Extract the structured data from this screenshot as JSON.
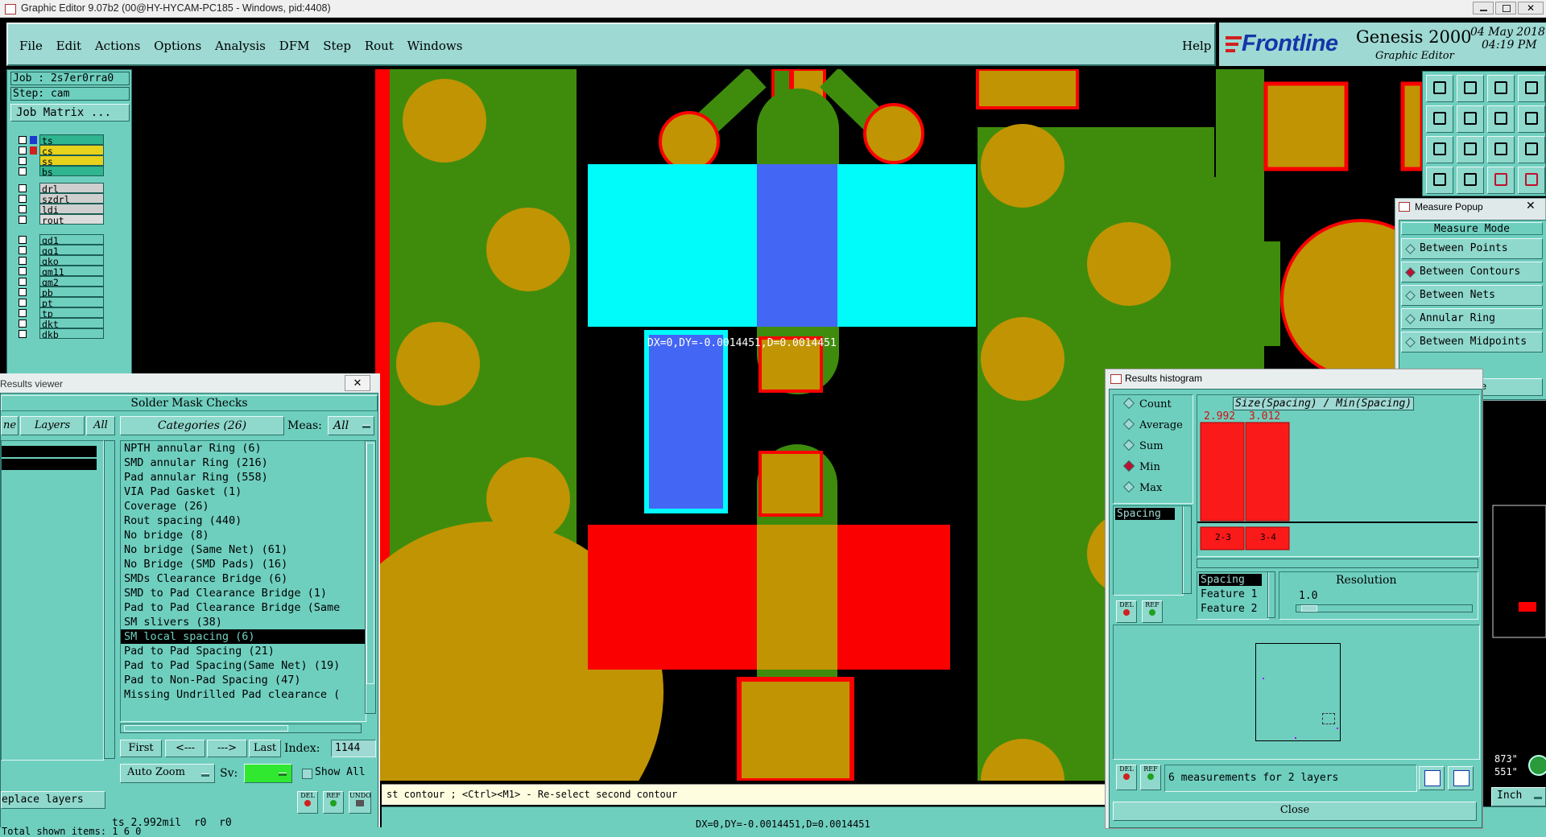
{
  "window": {
    "title": "Graphic Editor 9.07b2 (00@HY-HYCAM-PC185 - Windows, pid:4408)"
  },
  "menu": {
    "items": [
      "File",
      "Edit",
      "Actions",
      "Options",
      "Analysis",
      "DFM",
      "Step",
      "Rout",
      "Windows"
    ],
    "help": "Help"
  },
  "brand": {
    "logo": "Frontline",
    "product": "Genesis 2000",
    "subtitle": "Graphic Editor",
    "date": "04 May 2018",
    "time": "04:19 PM"
  },
  "job": {
    "job": "Job : 2s7er0rra0",
    "step": "Step: cam",
    "matrix_button": "Job Matrix ..."
  },
  "layers": {
    "group1": [
      "ts",
      "cs",
      "ss",
      "bs"
    ],
    "group2": [
      "drl",
      "szdrl",
      "ldi",
      "rout"
    ],
    "group3": [
      "gd1",
      "gg1",
      "gko",
      "gm11",
      "gm2",
      "pb",
      "pt",
      "tp",
      "dkt",
      "dkb"
    ]
  },
  "results_viewer": {
    "title": "Results viewer",
    "header": "Solder Mask Checks",
    "layers_tab": "Layers",
    "all_tab": "All",
    "ne_tab": "ne",
    "categories_label": "Categories (26)",
    "meas_label": "Meas:",
    "meas_value": "All",
    "categories": [
      "NPTH annular Ring (6)",
      "SMD annular Ring (216)",
      "Pad annular Ring (558)",
      "VIA Pad Gasket (1)",
      "Coverage (26)",
      "Rout spacing (440)",
      "No bridge (8)",
      "No bridge (Same Net) (61)",
      "No Bridge (SMD Pads) (16)",
      "SMDs Clearance Bridge (6)",
      "SMD to Pad Clearance Bridge (1)",
      "Pad to Pad Clearance Bridge (Same",
      "SM slivers (38)",
      "SM local spacing (6)",
      "Pad to Pad Spacing (21)",
      "Pad to Pad Spacing(Same Net) (19)",
      "Pad to Non-Pad Spacing (47)",
      "Missing Undrilled Pad clearance ("
    ],
    "selected_category_index": 13,
    "nav": {
      "first": "First",
      "prev": "<---",
      "next": "--->",
      "last": "Last",
      "index_label": "Index:",
      "index_value": "1144"
    },
    "auto_zoom": "Auto Zoom",
    "sv_label": "Sv:",
    "show_all": "Show All",
    "replace_layers": "eplace layers",
    "del": "DEL",
    "ref": "REF",
    "undo": "UNDO"
  },
  "measure_readout": {
    "overlay": "DX=0,DY=-0.0014451,D=0.0014451",
    "bottom": "DX=0,DY=-0.0014451,D=0.0014451"
  },
  "status": {
    "left": "ts 2.992mil  r0  r0",
    "bottom_left": "Total shown items: 1 6 0",
    "hint": "st contour ; <Ctrl><M1> - Re-select second contour",
    "units": "Inch",
    "coords_1": "873\"",
    "coords_2": "551\""
  },
  "measure_popup": {
    "title": "Measure Popup",
    "header": "Measure Mode",
    "modes": [
      "Between Points",
      "Between Contours",
      "Between Nets",
      "Annular Ring",
      "Between Midpoints"
    ],
    "selected_index": 1,
    "close": "Close"
  },
  "histogram": {
    "title": "Results histogram",
    "modes": [
      "Count",
      "Average",
      "Sum",
      "Min",
      "Max"
    ],
    "selected_mode_index": 3,
    "list_item": "Spacing",
    "chart_title": "Size(Spacing) / Min(Spacing)",
    "bars": [
      {
        "label": "2.992",
        "range": "2-3"
      },
      {
        "label": "3.012",
        "range": "3-4"
      }
    ],
    "fields": [
      "Spacing",
      "Feature 1",
      "Feature 2"
    ],
    "resolution_label": "Resolution",
    "resolution_value": "1.0",
    "summary": "6 measurements for 2 layers",
    "close": "Close",
    "del": "DEL",
    "ref": "REF"
  },
  "colors": {
    "board_green": "#3f8c0d",
    "pad_gold": "#c19403",
    "mask_red": "#fb0000",
    "cyan": "#00fbfb",
    "blue": "#4466f4",
    "ui_teal": "#6fcfbf"
  }
}
